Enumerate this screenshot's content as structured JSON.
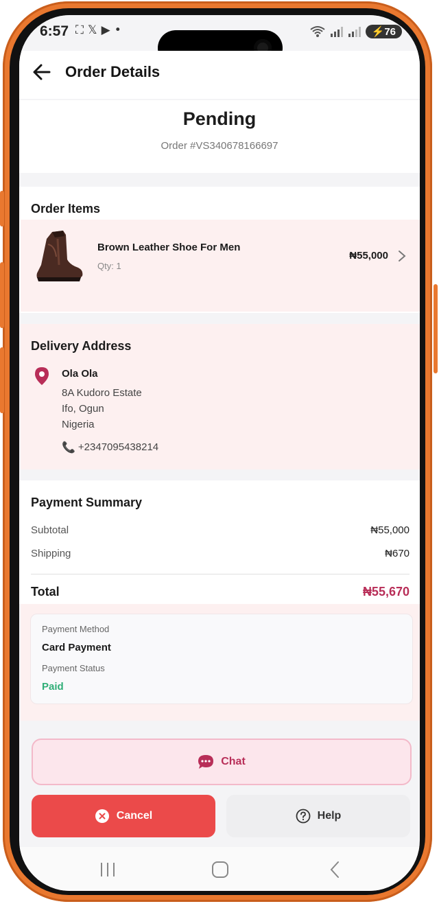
{
  "status_bar": {
    "time": "6:57",
    "left_icons": [
      "screenshot-icon",
      "x-icon",
      "youtube-icon",
      "dot-icon"
    ],
    "battery": "76"
  },
  "header": {
    "title": "Order Details"
  },
  "order": {
    "status": "Pending",
    "number": "Order #VS340678166697"
  },
  "items_section": {
    "title": "Order Items",
    "items": [
      {
        "name": "Brown Leather Shoe For Men",
        "qty": "Qty: 1",
        "price": "₦55,000"
      }
    ]
  },
  "address": {
    "title": "Delivery Address",
    "name": "Ola Ola",
    "lines": [
      "8A Kudoro Estate",
      "Ifo, Ogun",
      "Nigeria"
    ],
    "phone": "+2347095438214"
  },
  "payment_summary": {
    "title": "Payment Summary",
    "subtotal_label": "Subtotal",
    "subtotal_value": "₦55,000",
    "shipping_label": "Shipping",
    "shipping_value": "₦670",
    "total_label": "Total",
    "total_value": "₦55,670"
  },
  "payment_info": {
    "method_label": "Payment Method",
    "method_value": "Card Payment",
    "status_label": "Payment Status",
    "status_value": "Paid"
  },
  "actions": {
    "chat": "Chat",
    "cancel": "Cancel",
    "help": "Help"
  },
  "colors": {
    "accent": "#b82e58",
    "danger": "#eb4a4a",
    "success": "#2fae77",
    "pink_bg": "#fdf0f0",
    "frame": "#e9782f"
  }
}
